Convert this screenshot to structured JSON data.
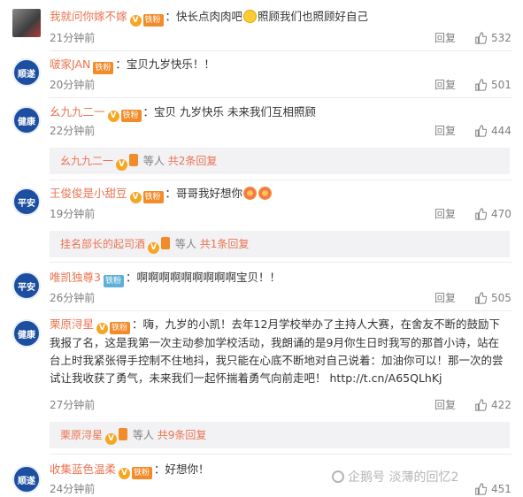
{
  "reply_label": "回复",
  "comments": [
    {
      "avatar_kind": "photo",
      "user": "我就问你嫁不嫁",
      "fan_badge": "铁粉",
      "text": "：快长点肉肉吧",
      "text_after": "照顾我们也照顾好自己",
      "time": "21分钟前",
      "likes": "532"
    },
    {
      "avatar_kind": "badge",
      "avatar_text": "顺遂",
      "user": "啵家JAN",
      "fan_badge": "铁粉",
      "text": "：宝贝九岁快乐！！",
      "time": "20分钟前",
      "likes": "501"
    },
    {
      "avatar_kind": "badge",
      "avatar_text": "健康",
      "user": "幺九九二一",
      "fan_badge": "铁粉",
      "text": "：宝贝 九岁快乐 未来我们互相照顾",
      "time": "22分钟前",
      "likes": "444",
      "sub": {
        "user": "幺九九二一",
        "mid": "等人",
        "more": "共2条回复"
      }
    },
    {
      "avatar_kind": "badge",
      "avatar_text": "平安",
      "user": "王俊俊是小甜豆",
      "fan_badge": "铁粉",
      "text": "：哥哥我好想你",
      "time": "19分钟前",
      "likes": "470",
      "sub": {
        "user": "挂名部长的起司酒",
        "mid": "等人",
        "more": "共1条回复"
      }
    },
    {
      "avatar_kind": "badge",
      "avatar_text": "平安",
      "user": "唯凯独尊3",
      "fan_badge": "铁粉",
      "text": "：啊啊啊啊啊啊啊啊啊宝贝！！",
      "time": "26分钟前",
      "likes": "505"
    },
    {
      "avatar_kind": "badge",
      "avatar_text": "健康",
      "user": "栗原浔星",
      "fan_badge": "铁粉",
      "text": "：嗨，九岁的小凯！去年12月学校举办了主持人大赛，在舍友不断的鼓励下我报了名，这是我第一次主动参加学校活动，我朗诵的是9月你生日时我写的那首小诗，站在台上时我紧张得手控制不住地抖，我只能在心底不断地对自己说着：加油你可以！那一次的尝试让我收获了勇气，未来我们一起怀揣着勇气向前走吧！",
      "link": "http://t.cn/A65QLhKj",
      "time": "27分钟前",
      "likes": "422",
      "sub": {
        "user": "栗原浔星",
        "mid": "等人",
        "more": "共9条回复"
      }
    },
    {
      "avatar_kind": "badge",
      "avatar_text": "顺遂",
      "user": "收集蓝色温柔",
      "fan_badge": "铁粉",
      "text": "：好想你！",
      "time": "24分钟前",
      "likes": "451"
    }
  ],
  "watermark": "企鹅号 淡薄的回忆2",
  "colors": {
    "username": "#eb7350",
    "meta": "#808080",
    "subbox": "#f2f2f5"
  }
}
